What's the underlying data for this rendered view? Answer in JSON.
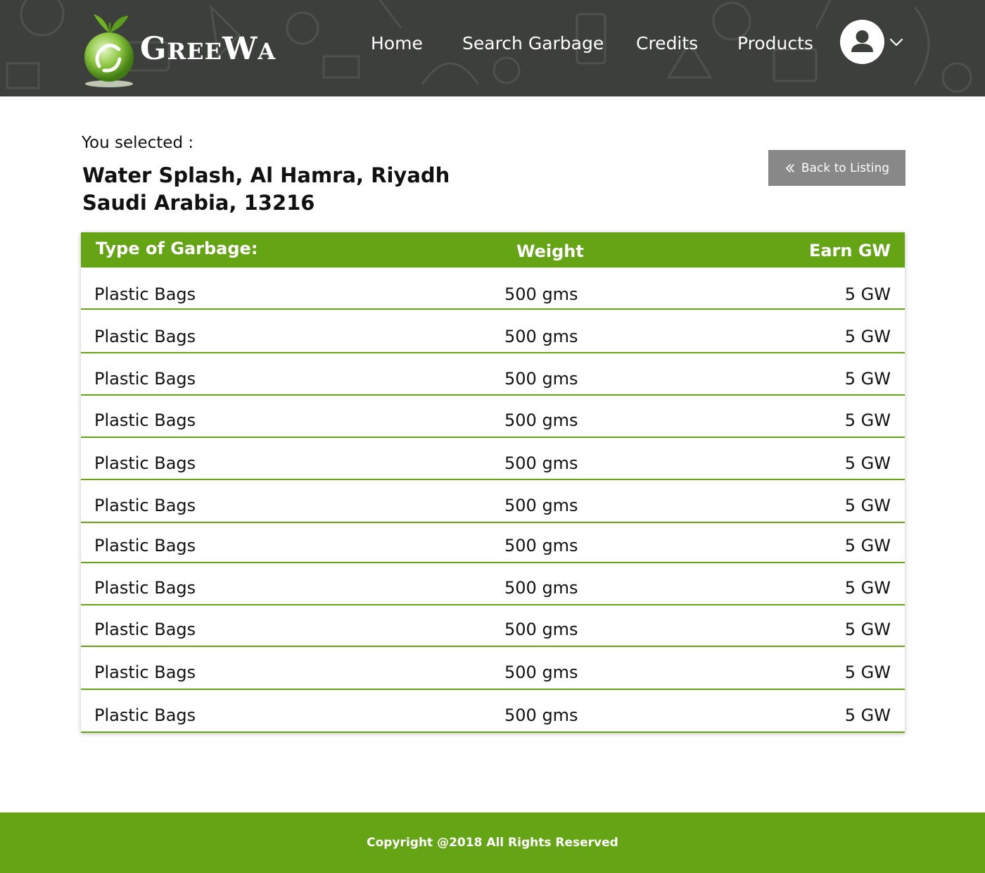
{
  "brand": {
    "name_first": "G",
    "name_mid": "REE",
    "name_second": "W",
    "name_last": "A"
  },
  "nav": {
    "items": [
      {
        "label": "Home"
      },
      {
        "label": "Search Garbage"
      },
      {
        "label": "Credits"
      },
      {
        "label": "Products"
      }
    ]
  },
  "icons": {
    "avatar": "user-icon",
    "caret": "chevron-down-icon",
    "back": "double-chevron-left-icon",
    "logo": "recycle-globe-icon"
  },
  "colors": {
    "header_bg": "#3d3f3c",
    "accent_green": "#65a515",
    "button_gray": "#888888"
  },
  "selection": {
    "label": "You selected :",
    "address_line1": "Water Splash, Al Hamra, Riyadh",
    "address_line2": "Saudi Arabia, 13216"
  },
  "back_button": {
    "label": "Back to Listing"
  },
  "table": {
    "headers": {
      "type": "Type of Garbage:",
      "weight": "Weight",
      "earn": "Earn GW"
    },
    "rows": [
      {
        "type": "Plastic Bags",
        "weight": "500  gms",
        "earn": "5 GW"
      },
      {
        "type": "Plastic Bags",
        "weight": "500  gms",
        "earn": "5 GW"
      },
      {
        "type": "Plastic Bags",
        "weight": "500  gms",
        "earn": "5 GW"
      },
      {
        "type": "Plastic Bags",
        "weight": "500  gms",
        "earn": "5 GW"
      },
      {
        "type": "Plastic Bags",
        "weight": "500  gms",
        "earn": "5 GW"
      },
      {
        "type": "Plastic Bags",
        "weight": "500  gms",
        "earn": "5 GW"
      },
      {
        "type": "Plastic Bags",
        "weight": "500  gms",
        "earn": "5 GW"
      },
      {
        "type": "Plastic Bags",
        "weight": "500  gms",
        "earn": "5 GW"
      },
      {
        "type": "Plastic Bags",
        "weight": "500  gms",
        "earn": "5 GW"
      },
      {
        "type": "Plastic Bags",
        "weight": "500  gms",
        "earn": "5 GW"
      },
      {
        "type": "Plastic Bags",
        "weight": "500  gms",
        "earn": "5 GW"
      }
    ]
  },
  "footer": {
    "text": "Copyright @2018 All Rights Reserved"
  }
}
